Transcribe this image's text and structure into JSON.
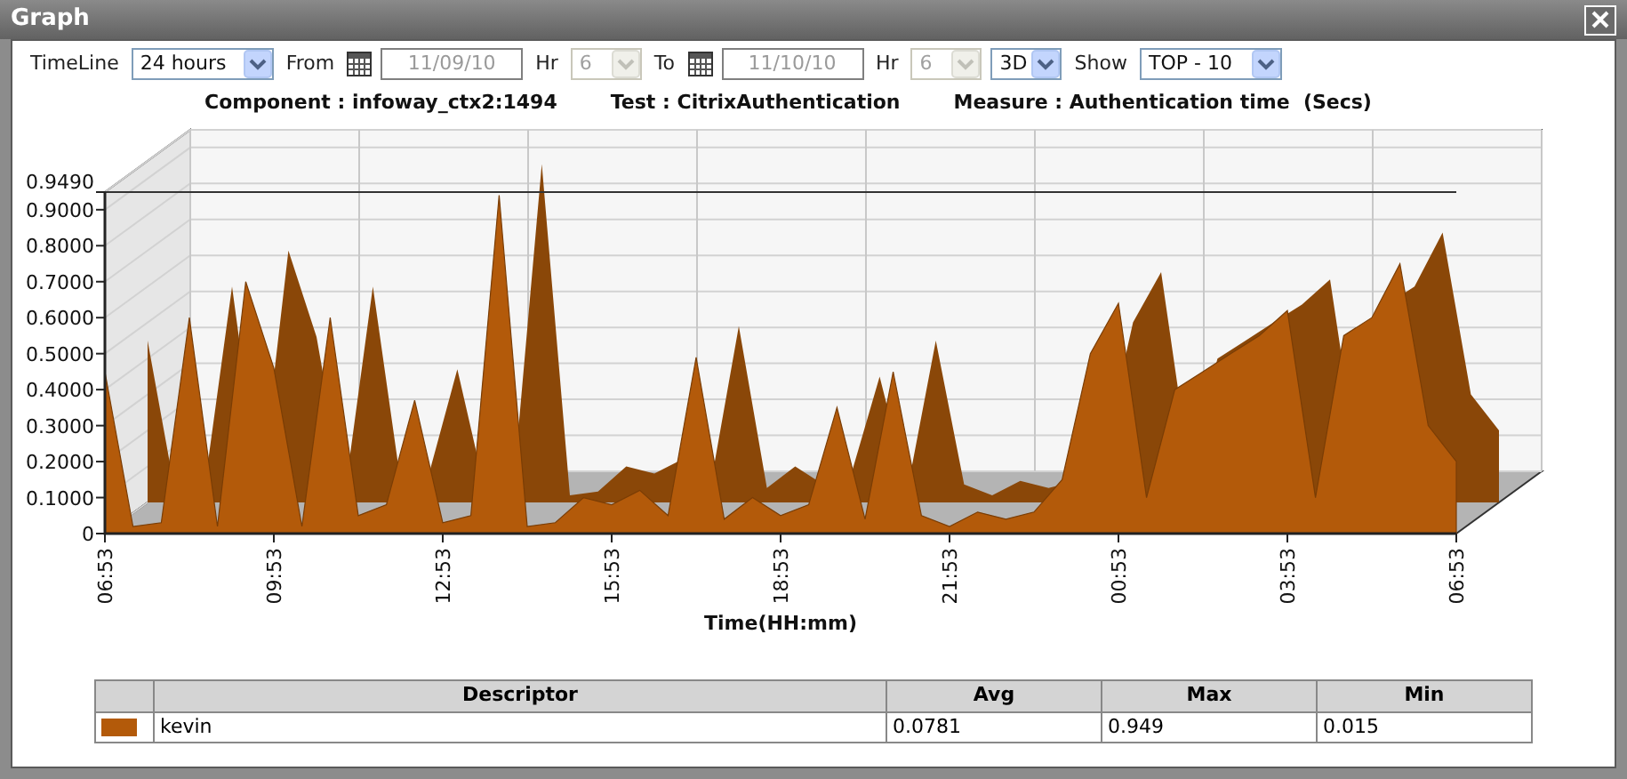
{
  "window": {
    "title": "Graph"
  },
  "toolbar": [
    {
      "kind": "label",
      "text": "TimeLine"
    },
    {
      "kind": "select",
      "value": "24 hours",
      "disabled": false
    },
    {
      "kind": "label",
      "text": "From"
    },
    {
      "kind": "calendar"
    },
    {
      "kind": "date",
      "value": "11/09/10",
      "disabled": true
    },
    {
      "kind": "label",
      "text": "Hr"
    },
    {
      "kind": "select",
      "value": "6",
      "disabled": true
    },
    {
      "kind": "label",
      "text": "To"
    },
    {
      "kind": "calendar"
    },
    {
      "kind": "date",
      "value": "11/10/10",
      "disabled": true
    },
    {
      "kind": "label",
      "text": "Hr"
    },
    {
      "kind": "select",
      "value": "6",
      "disabled": true
    },
    {
      "kind": "select",
      "value": "3D",
      "disabled": false
    },
    {
      "kind": "label",
      "text": "Show"
    },
    {
      "kind": "select",
      "value": "TOP - 10",
      "disabled": false
    }
  ],
  "chart_header": [
    "Component : infoway_ctx2:1494",
    "Test : CitrixAuthentication",
    "Measure : Authentication time  (Secs)"
  ],
  "chart_data": {
    "type": "area",
    "xlabel": "Time(HH:mm)",
    "categories": [
      "06:53",
      null,
      null,
      null,
      null,
      null,
      "09:53",
      null,
      null,
      null,
      null,
      null,
      "12:53",
      null,
      null,
      null,
      null,
      null,
      "15:53",
      null,
      null,
      null,
      null,
      null,
      "18:53",
      null,
      null,
      null,
      null,
      null,
      "21:53",
      null,
      null,
      null,
      null,
      null,
      "00:53",
      null,
      null,
      null,
      null,
      null,
      "03:53",
      null,
      null,
      null,
      null,
      null,
      "06:53"
    ],
    "series": [
      {
        "color": "#b35a0a",
        "values": [
          0.45,
          0.02,
          0.03,
          0.6,
          0.02,
          0.7,
          0.46,
          0.02,
          0.6,
          0.05,
          0.08,
          0.37,
          0.03,
          0.05,
          0.94,
          0.02,
          0.03,
          0.1,
          0.08,
          0.12,
          0.05,
          0.49,
          0.04,
          0.1,
          0.05,
          0.08,
          0.35,
          0.04,
          0.45,
          0.05,
          0.02,
          0.06,
          0.04,
          0.06,
          0.15,
          0.5,
          0.64,
          0.1,
          0.4,
          0.45,
          0.5,
          0.55,
          0.62,
          0.1,
          0.55,
          0.6,
          0.75,
          0.3,
          0.2
        ]
      }
    ],
    "ylim": [
      0,
      0.949
    ],
    "grid": true,
    "yticks": [
      {
        "value": 0,
        "label": "0"
      },
      {
        "value": 0.1,
        "label": "0.1000"
      },
      {
        "value": 0.2,
        "label": "0.2000"
      },
      {
        "value": 0.3,
        "label": "0.3000"
      },
      {
        "value": 0.4,
        "label": "0.4000"
      },
      {
        "value": 0.5,
        "label": "0.5000"
      },
      {
        "value": 0.6,
        "label": "0.6000"
      },
      {
        "value": 0.7,
        "label": "0.7000"
      },
      {
        "value": 0.8,
        "label": "0.8000"
      },
      {
        "value": 0.9,
        "label": "0.9000"
      },
      {
        "value": 0.949,
        "label": "0.9490"
      }
    ]
  },
  "legend_table": {
    "columns": [
      "Descriptor",
      "Avg",
      "Max",
      "Min"
    ],
    "rows": [
      {
        "color": "#b35a0a",
        "descriptor": "kevin",
        "avg": "0.0781",
        "max": "0.949",
        "min": "0.015"
      }
    ]
  }
}
